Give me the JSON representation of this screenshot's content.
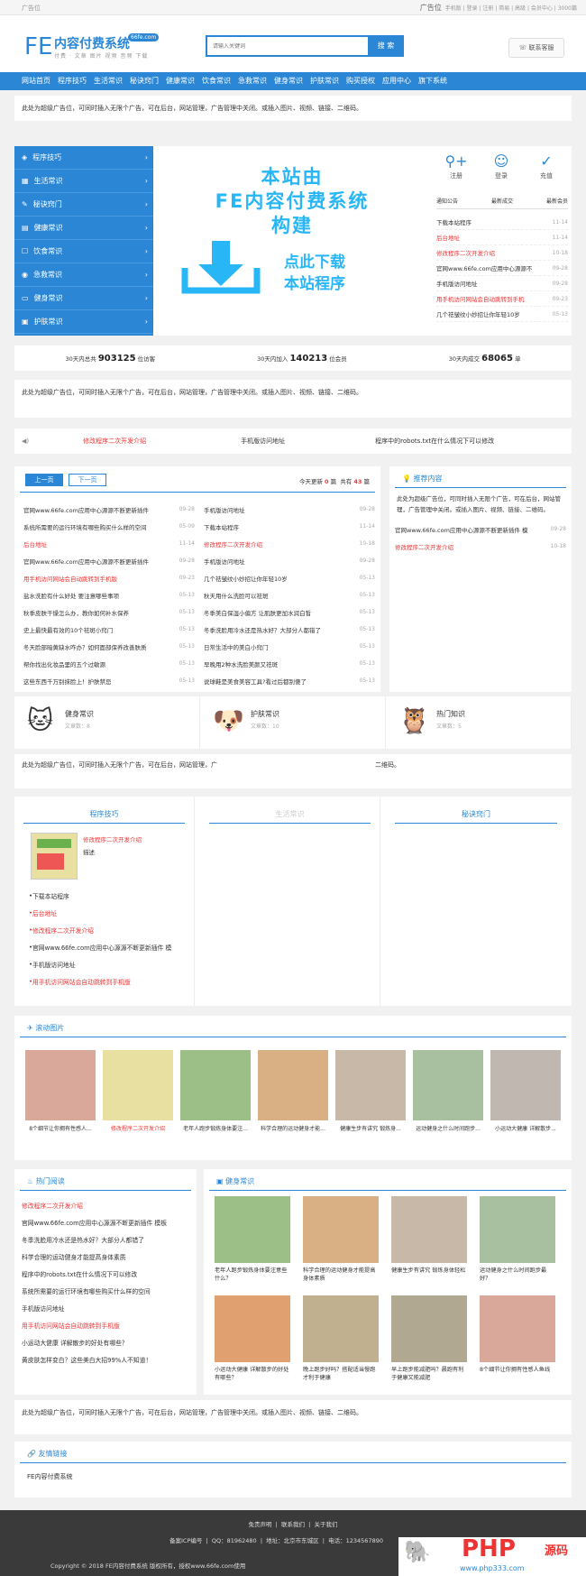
{
  "topbar": {
    "left": "广告位",
    "ad_label": "广告位",
    "links": "手机版 | 登录 | 注册 | 简易 | 高级 | 会员中心 | 3000篇"
  },
  "header": {
    "logo_fe": "FE",
    "logo_name": "内容付费系统",
    "logo_badge": "66fe.com",
    "logo_sub": "付费 · 文章 图片 视频 音频 下载",
    "search_placeholder": "请输入关键词",
    "search_btn": "搜 索",
    "service": "联系客服"
  },
  "nav": [
    "网站首页",
    "程序技巧",
    "生活常识",
    "秘诀窍门",
    "健康常识",
    "饮食常识",
    "急救常识",
    "健身常识",
    "护肤常识",
    "购买授权",
    "应用中心",
    "旗下系统"
  ],
  "ad_text": "此处为超级广告位，可同时插入无限个广告，可在后台，网站管理，广告管理中关闭。或插入图片、视频、链接、二维码。",
  "ad_text_cut": "此处为超级广告位，可同时插入无限个广告，可在后台，网站管理，广",
  "ad_text_tail": "二维码。",
  "sidebar": [
    {
      "icon": "◈",
      "label": "程序技巧"
    },
    {
      "icon": "▦",
      "label": "生活常识"
    },
    {
      "icon": "✎",
      "label": "秘诀窍门"
    },
    {
      "icon": "▤",
      "label": "健康常识"
    },
    {
      "icon": "☐",
      "label": "饮食常识"
    },
    {
      "icon": "◉",
      "label": "急救常识"
    },
    {
      "icon": "▭",
      "label": "健身常识"
    },
    {
      "icon": "▣",
      "label": "护肤常识"
    }
  ],
  "banner": {
    "line1": "本站由",
    "line2": "FE内容付费系统",
    "line3": "构建",
    "line4": "点此下载",
    "line5": "本站程序"
  },
  "rpanel": {
    "register": "注册",
    "login": "登录",
    "recharge": "充值",
    "tabs": [
      "通知公告",
      "最新成交",
      "最新会员"
    ],
    "list": [
      {
        "t": "下载本站程序",
        "d": "11-14",
        "red": false
      },
      {
        "t": "后台地址",
        "d": "11-14",
        "red": true
      },
      {
        "t": "修改程序二次开发介绍",
        "d": "10-18",
        "red": true
      },
      {
        "t": "官网www.66fe.com应用中心源源不",
        "d": "09-28",
        "red": false
      },
      {
        "t": "手机版访问地址",
        "d": "09-28",
        "red": false
      },
      {
        "t": "用手机访问网站会自动跳转到手机",
        "d": "09-23",
        "red": true
      },
      {
        "t": "几个祛皱纹小妙招让你年轻10岁",
        "d": "05-13",
        "red": false
      }
    ]
  },
  "stats": [
    {
      "label": "30天内总共",
      "num": "903125",
      "unit": "位访客"
    },
    {
      "label": "30天内加入",
      "num": "140213",
      "unit": "位会员"
    },
    {
      "label": "30天内成交",
      "num": "68065",
      "unit": "单"
    }
  ],
  "notice": {
    "icon": "◀)",
    "items": [
      "修改程序二次开发介绍",
      "手机版访问地址",
      "程序中的robots.txt在什么情况下可以修改"
    ]
  },
  "news": {
    "prev": "上一页",
    "next": "下一页",
    "today_label": "今天更新",
    "today_num": "0",
    "today_unit": "篇",
    "total_label": "共有",
    "total_num": "43",
    "total_unit": "篇",
    "left": [
      {
        "t": "官网www.66fe.com应用中心源源不断更新插件",
        "d": "09-28",
        "red": false
      },
      {
        "t": "系统所需要的运行环境有哪些购买什么样的空间",
        "d": "05-09",
        "red": false
      },
      {
        "t": "后台地址",
        "d": "11-14",
        "red": true
      },
      {
        "t": "官网www.66fe.com应用中心源源不断更新插件",
        "d": "09-28",
        "red": false
      },
      {
        "t": "用手机访问网站会自动跳转到手机版",
        "d": "09-23",
        "red": true
      },
      {
        "t": "盐水洗脸有什么好处 要注意哪些事项",
        "d": "05-13",
        "red": false
      },
      {
        "t": "秋季皮肤干燥怎么办，教你如何补水保养",
        "d": "05-13",
        "red": false
      },
      {
        "t": "史上最快最有效的10个祛斑小窍门",
        "d": "05-13",
        "red": false
      },
      {
        "t": "冬天脸部暗黄缺水咋办？如何面部保养改善肤质",
        "d": "05-13",
        "red": false
      },
      {
        "t": "帮你找出化妆品里的五个过敏源",
        "d": "05-13",
        "red": false
      },
      {
        "t": "这些东西千万别抹脸上！护肤禁忌",
        "d": "05-13",
        "red": false
      }
    ],
    "right": [
      {
        "t": "手机版访问地址",
        "d": "09-28",
        "red": false
      },
      {
        "t": "下载本站程序",
        "d": "11-14",
        "red": false
      },
      {
        "t": "修改程序二次开发介绍",
        "d": "10-18",
        "red": true
      },
      {
        "t": "手机版访问地址",
        "d": "09-28",
        "red": false
      },
      {
        "t": "几个祛皱纹小妙招让你年轻10岁",
        "d": "05-13",
        "red": false
      },
      {
        "t": "秋天用什么洗脸可以祛斑",
        "d": "05-13",
        "red": false
      },
      {
        "t": "冬季美白保湿小偏方 让肌肤更加水润白皙",
        "d": "05-13",
        "red": false
      },
      {
        "t": "冬季洗脸用冷水还是热水好？大部分人都错了",
        "d": "05-13",
        "red": false
      },
      {
        "t": "日常生活中的美白小窍门",
        "d": "05-13",
        "red": false
      },
      {
        "t": "早晚用2种水洗脸美颜又祛斑",
        "d": "05-13",
        "red": false
      },
      {
        "t": "说球鞋是美食美容工具?看过后都别傻了",
        "d": "05-13",
        "red": false
      }
    ]
  },
  "recommend": {
    "title": "推荐内容",
    "ad": "此处为超级广告位，可同时插入无限个广告，可在后台，网站管理，广告管理中关闭。或插入图片、视频、链接、二维码。",
    "items": [
      {
        "t": "官网www.66fe.com应用中心源源不断更新插件 模",
        "d": "09-28",
        "red": false
      },
      {
        "t": "修改程序二次开发介绍",
        "d": "10-18",
        "red": true
      }
    ]
  },
  "cats": [
    {
      "name": "健身常识",
      "sub": "文章数：8",
      "emoji": "🐱"
    },
    {
      "name": "护肤常识",
      "sub": "文章数：10",
      "emoji": "🐶"
    },
    {
      "name": "热门知识",
      "sub": "文章数：5",
      "emoji": "🦉"
    }
  ],
  "col3": {
    "titles": [
      "程序技巧",
      "生活常识",
      "秘诀窍门"
    ],
    "feature_title": "修改程序二次开发介绍",
    "feature_desc": "描述",
    "list": [
      {
        "t": "下载本站程序",
        "red": false
      },
      {
        "t": "后台地址",
        "red": true
      },
      {
        "t": "修改程序二次开发介绍",
        "red": true
      },
      {
        "t": "官网www.66fe.com应用中心源源不断更新插件 模",
        "red": false
      },
      {
        "t": "手机版访问地址",
        "red": false
      },
      {
        "t": "用手机访问网站会自动跳转到手机版",
        "red": true
      }
    ]
  },
  "scroll": {
    "title": "滚动图片",
    "items": [
      {
        "cap": "8个细节让你拥有性感人...",
        "red": false,
        "bg": "#d9a89a"
      },
      {
        "cap": "修改程序二次开发介绍",
        "red": true,
        "bg": "#e8e0a0"
      },
      {
        "cap": "老年人跑步锻炼身体要注...",
        "red": false,
        "bg": "#9cbf88"
      },
      {
        "cap": "科学合理的运动健身才能...",
        "red": false,
        "bg": "#d8b084"
      },
      {
        "cap": "健康生步有讲究 锻炼身...",
        "red": false,
        "bg": "#c8b8a8"
      },
      {
        "cap": "运动健身之什么时间跑步...",
        "red": false,
        "bg": "#a8c0a0"
      },
      {
        "cap": "小运动大健康 详解散步...",
        "red": false,
        "bg": "#c0b8b0"
      }
    ]
  },
  "hot": {
    "title": "热门阅读",
    "items": [
      {
        "t": "修改程序二次开发介绍",
        "red": true
      },
      {
        "t": "官网www.66fe.com应用中心源源不断更新插件 模板",
        "red": false
      },
      {
        "t": "冬季洗脸用冷水还是热水好？大部分人都错了",
        "red": false
      },
      {
        "t": "科学合理的运动健身才能提高身体素质",
        "red": false
      },
      {
        "t": "程序中的robots.txt在什么情况下可以修改",
        "red": false
      },
      {
        "t": "系统所需要的运行环境有哪些购买什么样的空间",
        "red": false
      },
      {
        "t": "手机版访问地址",
        "red": false
      },
      {
        "t": "用手机访问网站会自动跳转到手机版",
        "red": true
      },
      {
        "t": "小运动大健康 详解散步的好处有哪些？",
        "red": false
      },
      {
        "t": "黄皮肤怎样变白？这些美白大招99%人不知道！",
        "red": false
      }
    ]
  },
  "fitness": {
    "title": "健身常识",
    "items": [
      {
        "cap": "老年人跑步锻炼身体要注意些什么？",
        "bg": "#9cbf88"
      },
      {
        "cap": "科学合理的运动健身才能提高身体素质",
        "bg": "#d8b084"
      },
      {
        "cap": "健康生步有讲究 锻炼身体轻松",
        "bg": "#c8b8a8"
      },
      {
        "cap": "运动健身之什么时间跑步最好？",
        "bg": "#a8c0a0"
      },
      {
        "cap": "小运动大健康 详解散步的好处有哪些？",
        "bg": "#e0a070"
      },
      {
        "cap": "晚上跑步好吗？搭配适当慢跑才利于健康",
        "bg": "#c0b090"
      },
      {
        "cap": "早上跑步能减肥吗？晨跑有利于健康又能减肥",
        "bg": "#b0a890"
      },
      {
        "cap": "8个细节让你拥有性感人鱼线",
        "bg": "#d9a89a"
      }
    ]
  },
  "links": {
    "title": "友情链接",
    "items": [
      "FE内容付费系统"
    ]
  },
  "footer": {
    "links": [
      "免责声明",
      "联系我们",
      "关于我们"
    ],
    "icp": "备案ICP编号",
    "qq": "QQ：81962480",
    "addr": "地址：北京市东城区",
    "tel": "电话：1234567890",
    "copyright": "Copyright © 2018 FE内容付费系统 版权所有，授权www.66fe.com使用",
    "watermark": "PHP",
    "watermark2": "源码",
    "watermark_url": "www.php333.com"
  }
}
